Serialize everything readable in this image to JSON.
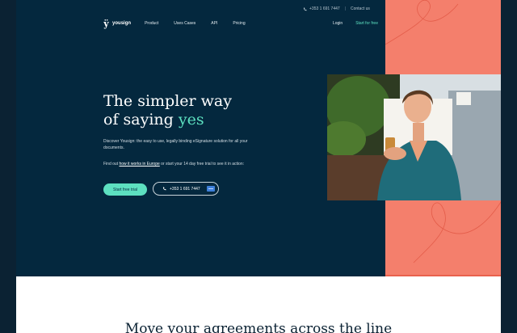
{
  "topbar": {
    "phone": "+353 1 691 7447",
    "separator": "|",
    "contact": "Contact us"
  },
  "brand": {
    "name": "yousign"
  },
  "nav": {
    "items": [
      {
        "label": "Product"
      },
      {
        "label": "Uses Cases"
      },
      {
        "label": "API"
      },
      {
        "label": "Pricing"
      }
    ],
    "login": "Login",
    "start": "Start for free"
  },
  "hero": {
    "headline_line1": "The simpler way",
    "headline_line2_prefix": "of saying ",
    "headline_accent": "yes",
    "description": "Discover Yousign: the easy to use, legally binding eSignature solution for all your documents.",
    "find_out_prefix": "Find out ",
    "find_out_link": "how it works in Europe",
    "find_out_suffix": " or start your 14 day free trial to see it in action:",
    "trial_button": "Start free trial",
    "phone_button": "+353 1 691 7447"
  },
  "section2": {
    "title": "Move your agreements across the line"
  },
  "colors": {
    "navy": "#04283e",
    "coral": "#f47f6c",
    "mint": "#5de0c0"
  },
  "icons": [
    "phone-icon",
    "flag-icon",
    "yousign-logo-icon"
  ]
}
